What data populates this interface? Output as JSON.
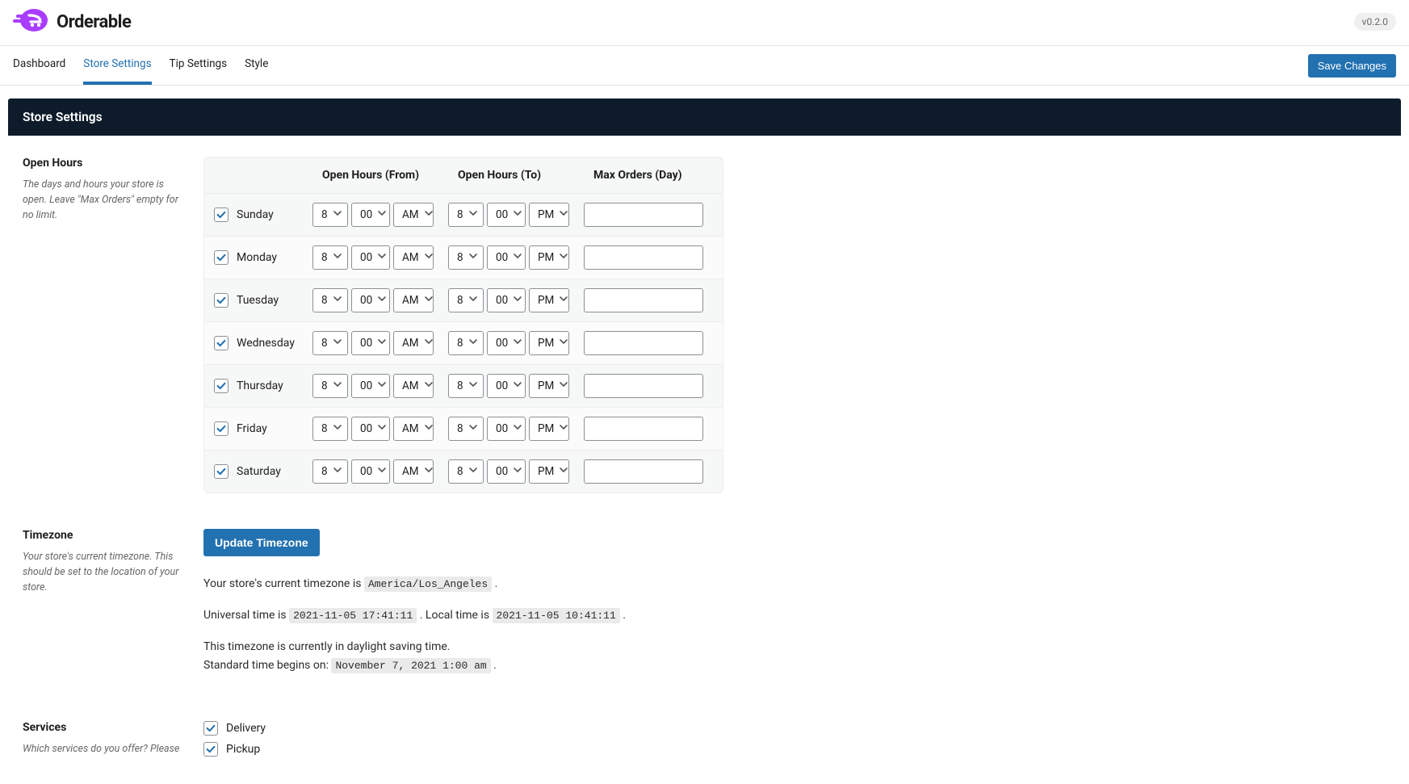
{
  "header": {
    "brand": "Orderable",
    "version": "v0.2.0"
  },
  "nav": {
    "tabs": [
      "Dashboard",
      "Store Settings",
      "Tip Settings",
      "Style"
    ],
    "active": 1,
    "save": "Save Changes"
  },
  "page": {
    "title": "Store Settings"
  },
  "open_hours": {
    "title": "Open Hours",
    "desc": "The days and hours your store is open. Leave \"Max Orders\" empty for no limit.",
    "cols": {
      "from": "Open Hours (From)",
      "to": "Open Hours (To)",
      "max": "Max Orders (Day)"
    },
    "days": [
      {
        "name": "Sunday",
        "enabled": true,
        "from_h": "8",
        "from_m": "00",
        "from_ap": "AM",
        "to_h": "8",
        "to_m": "00",
        "to_ap": "PM",
        "max": ""
      },
      {
        "name": "Monday",
        "enabled": true,
        "from_h": "8",
        "from_m": "00",
        "from_ap": "AM",
        "to_h": "8",
        "to_m": "00",
        "to_ap": "PM",
        "max": ""
      },
      {
        "name": "Tuesday",
        "enabled": true,
        "from_h": "8",
        "from_m": "00",
        "from_ap": "AM",
        "to_h": "8",
        "to_m": "00",
        "to_ap": "PM",
        "max": ""
      },
      {
        "name": "Wednesday",
        "enabled": true,
        "from_h": "8",
        "from_m": "00",
        "from_ap": "AM",
        "to_h": "8",
        "to_m": "00",
        "to_ap": "PM",
        "max": ""
      },
      {
        "name": "Thursday",
        "enabled": true,
        "from_h": "8",
        "from_m": "00",
        "from_ap": "AM",
        "to_h": "8",
        "to_m": "00",
        "to_ap": "PM",
        "max": ""
      },
      {
        "name": "Friday",
        "enabled": true,
        "from_h": "8",
        "from_m": "00",
        "from_ap": "AM",
        "to_h": "8",
        "to_m": "00",
        "to_ap": "PM",
        "max": ""
      },
      {
        "name": "Saturday",
        "enabled": true,
        "from_h": "8",
        "from_m": "00",
        "from_ap": "AM",
        "to_h": "8",
        "to_m": "00",
        "to_ap": "PM",
        "max": ""
      }
    ]
  },
  "timezone": {
    "title": "Timezone",
    "desc": "Your store's current timezone. This should be set to the location of your store.",
    "button": "Update Timezone",
    "line1_pre": "Your store's current timezone is ",
    "tz_value": "America/Los_Angeles",
    "line2_pre": "Universal time is ",
    "utc": "2021-11-05 17:41:11",
    "line2_mid": " . Local time is ",
    "local": "2021-11-05 10:41:11",
    "line3": "This timezone is currently in daylight saving time.",
    "line4_pre": "Standard time begins on: ",
    "std": "November 7, 2021 1:00 am"
  },
  "services": {
    "title": "Services",
    "desc": "Which services do you offer? Please",
    "items": [
      {
        "label": "Delivery",
        "checked": true
      },
      {
        "label": "Pickup",
        "checked": true
      }
    ]
  },
  "colors": {
    "accent": "#2271b1",
    "brand_purple": "#a93cff",
    "header_dark": "#0d1b2a"
  }
}
